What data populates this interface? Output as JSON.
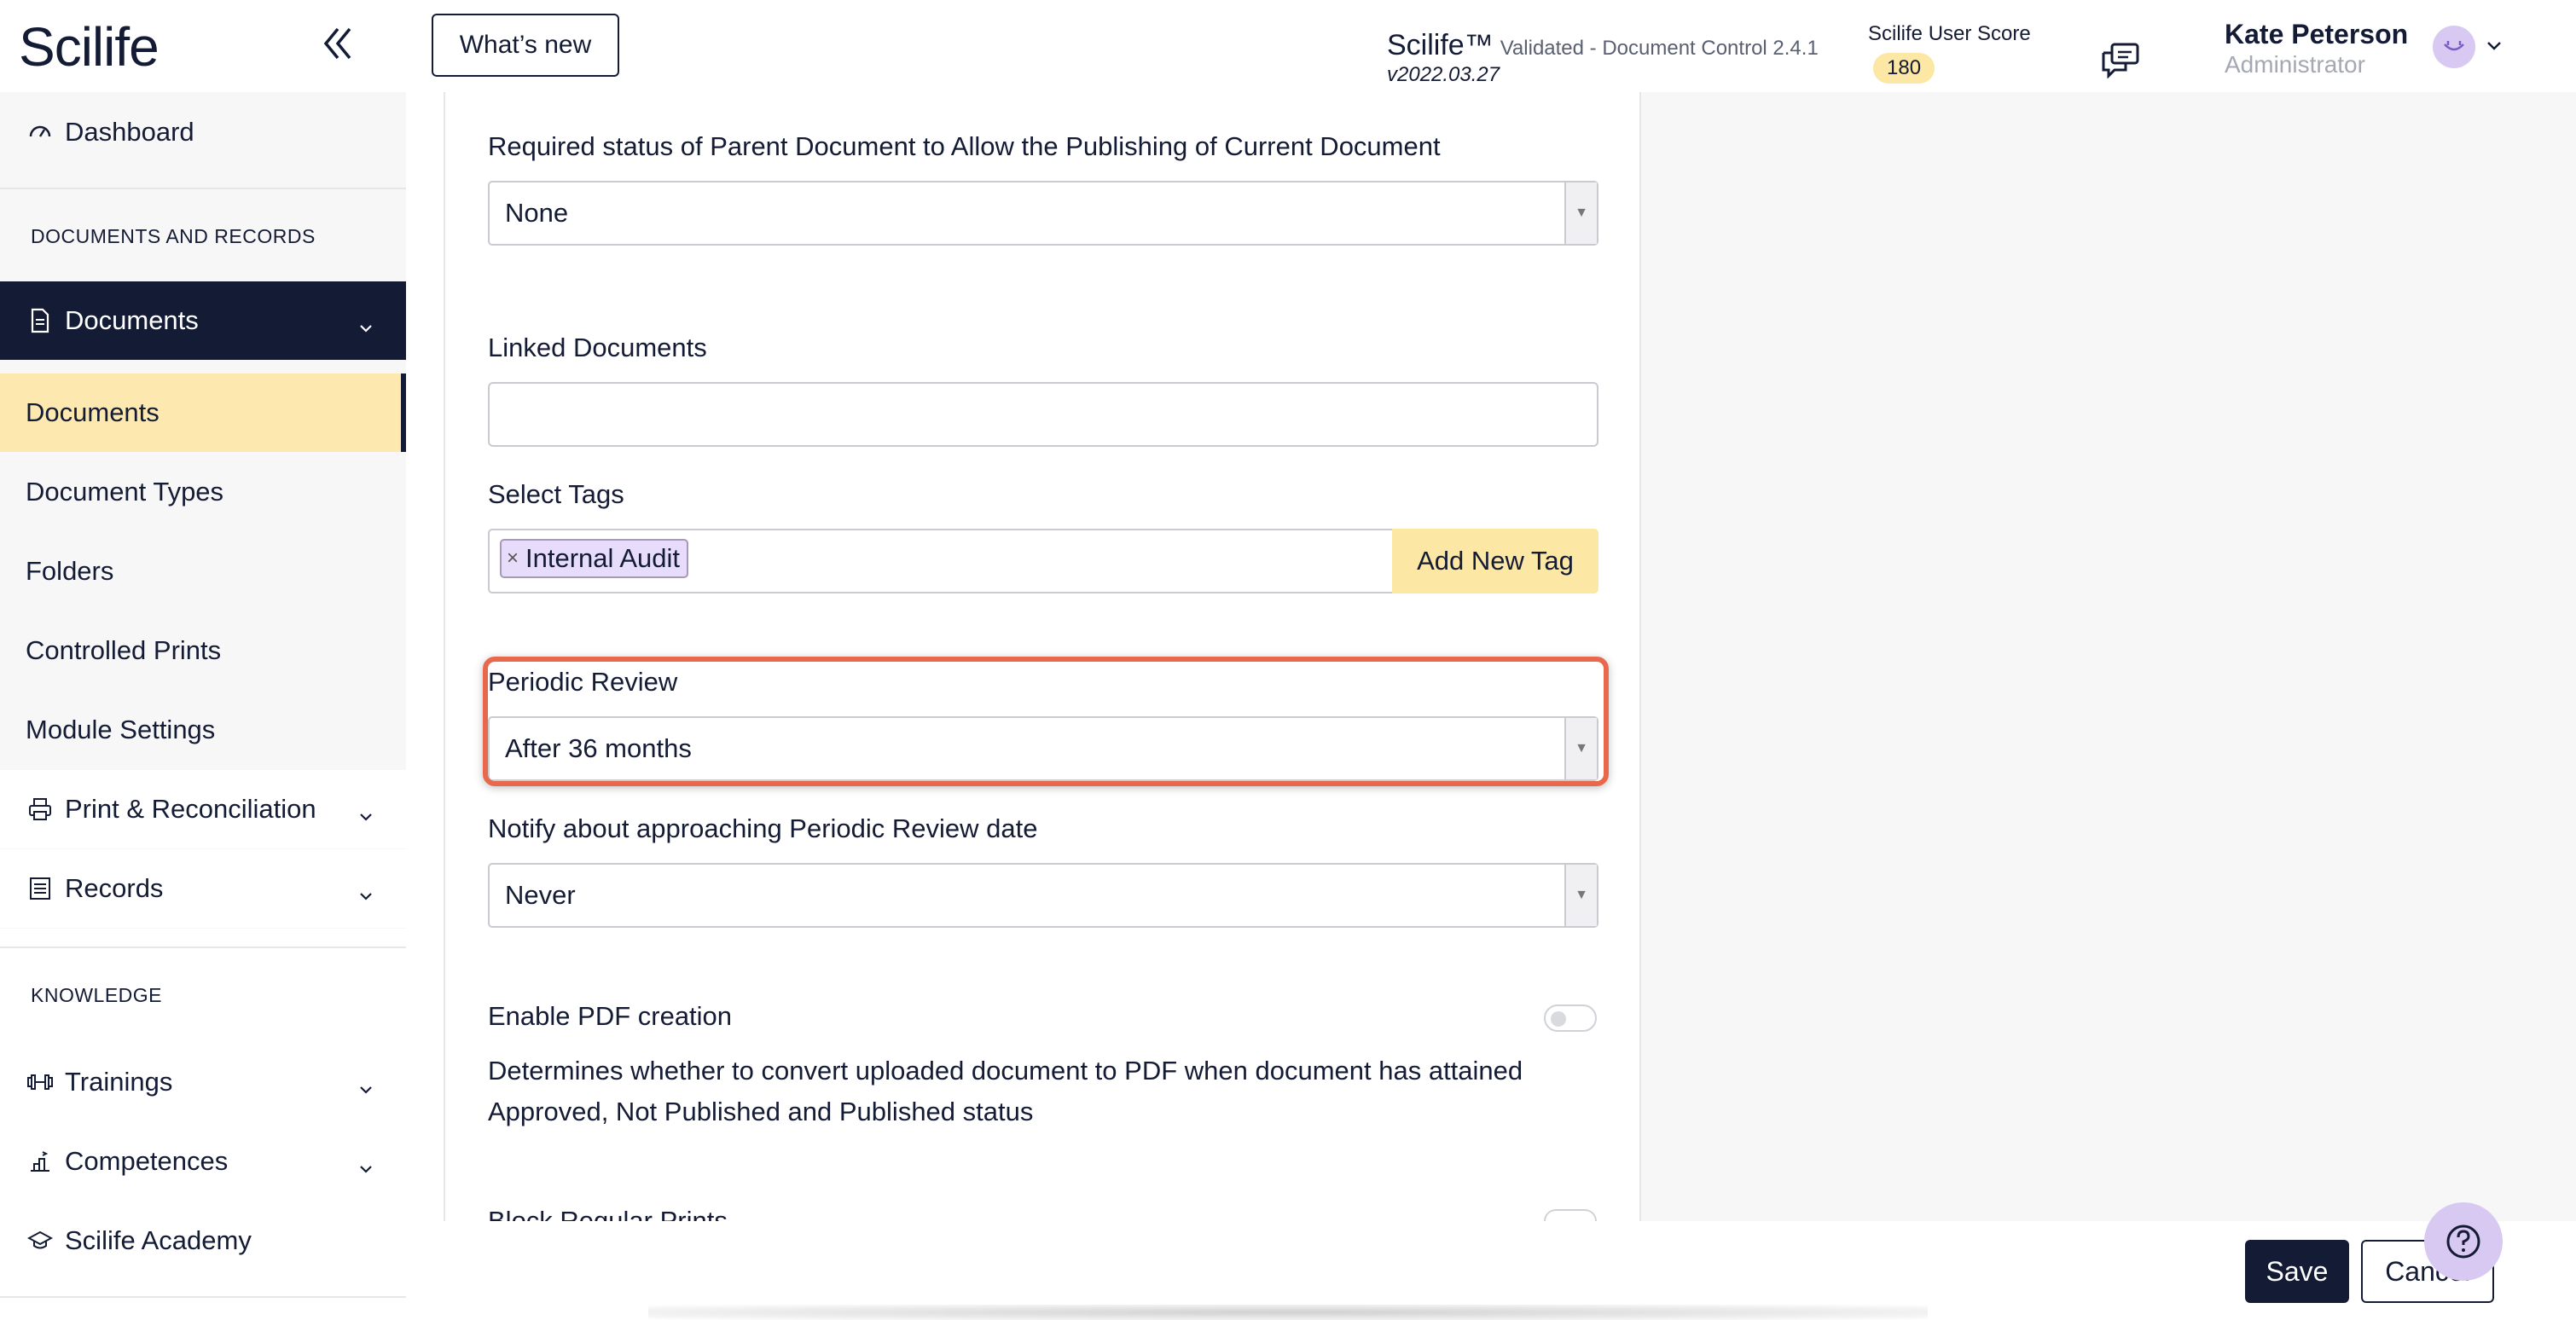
{
  "header": {
    "logo": "Scilife",
    "whats_new": "What’s new",
    "app_name": "Scilife™",
    "app_sub": "Validated - Document Control 2.4.1",
    "app_version": "v2022.03.27",
    "user_score_label": "Scilife User Score",
    "user_score": "180",
    "user_name": "Kate Peterson",
    "user_role": "Administrator"
  },
  "sidebar": {
    "dashboard": "Dashboard",
    "section_docs": "DOCUMENTS AND RECORDS",
    "documents_group": "Documents",
    "documents": "Documents",
    "document_types": "Document Types",
    "folders": "Folders",
    "controlled_prints": "Controlled Prints",
    "module_settings": "Module Settings",
    "print_reconciliation": "Print & Reconciliation",
    "records": "Records",
    "section_knowledge": "KNOWLEDGE",
    "trainings": "Trainings",
    "competences": "Competences",
    "academy": "Scilife Academy"
  },
  "form": {
    "parent_status_label": "Required status of Parent Document to Allow the Publishing of Current Document",
    "parent_status_value": "None",
    "linked_docs_label": "Linked Documents",
    "linked_docs_value": "",
    "tags_label": "Select Tags",
    "tag_1": "Internal Audit",
    "add_tag": "Add New Tag",
    "periodic_review_label": "Periodic Review",
    "periodic_review_value": "After 36 months",
    "notify_label": "Notify about approaching Periodic Review date",
    "notify_value": "Never",
    "pdf_label": "Enable PDF creation",
    "pdf_desc": "Determines whether to convert uploaded document to PDF when document has attained Approved, Not Published and Published status",
    "block_prints_label": "Block Regular Prints"
  },
  "footer": {
    "save": "Save",
    "cancel": "Cancel"
  },
  "colors": {
    "navy": "#141b34",
    "highlight": "#e8684d",
    "yellow": "#fde7a4",
    "lavender": "#d8c9f3"
  }
}
